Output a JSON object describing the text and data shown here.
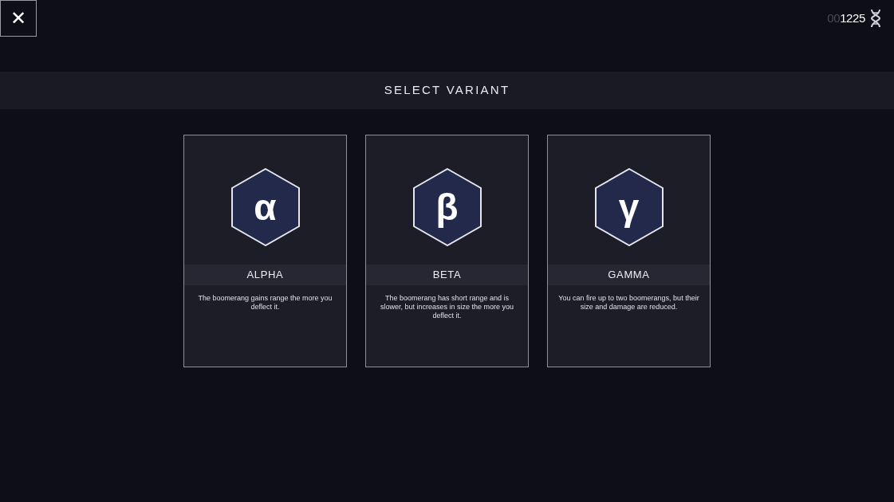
{
  "close_button": {
    "symbol": "✕"
  },
  "currency": {
    "leading_zeros": "00",
    "value": "1225"
  },
  "header": {
    "title": "SELECT VARIANT"
  },
  "variants": [
    {
      "symbol": "α",
      "name": "ALPHA",
      "description": "The boomerang gains range the more you deflect it."
    },
    {
      "symbol": "β",
      "name": "BETA",
      "description": "The boomerang has short range and is slower, but increases in size the more you deflect it."
    },
    {
      "symbol": "γ",
      "name": "GAMMA",
      "description": "You can fire up to two boomerangs, but their size and damage are reduced."
    }
  ]
}
